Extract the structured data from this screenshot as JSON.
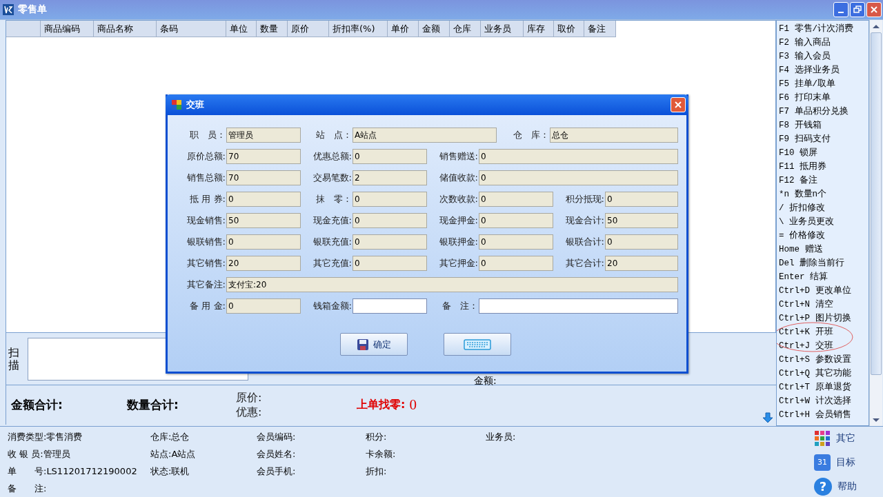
{
  "window": {
    "title": "零售单"
  },
  "table": {
    "columns": [
      "",
      "商品编码",
      "商品名称",
      "条码",
      "单位",
      "数量",
      "原价",
      "折扣率(%)",
      "单价",
      "金额",
      "仓库",
      "业务员",
      "库存",
      "取价",
      "备注"
    ]
  },
  "shortcuts": [
    "F1 零售/计次消费",
    "F2 输入商品",
    "F3 输入会员",
    "F4 选择业务员",
    "F5 挂单/取单",
    "F6 打印末单",
    "F7 单品积分兑换",
    "F8 开钱箱",
    "F9 扫码支付",
    "F10 锁屏",
    "F11 抵用券",
    "F12 备注",
    "*n  数量n个",
    "/ 折扣修改",
    "\\ 业务员更改",
    "= 价格修改",
    "Home 赠送",
    "Del 删除当前行",
    "Enter 结算",
    "Ctrl+D 更改单位",
    "Ctrl+N 清空",
    "Ctrl+P 图片切换",
    "Ctrl+K 开班",
    "Ctrl+J 交班",
    "Ctrl+S 参数设置",
    "Ctrl+Q 其它功能",
    "Ctrl+T 原单退货",
    "Ctrl+W 计次选择",
    "Ctrl+H 会员销售"
  ],
  "scan": {
    "label": "扫描",
    "amount_label": "金额:"
  },
  "totals": {
    "amount_label": "金额合计:",
    "qty_label": "数量合计:",
    "orig_label": "原价:",
    "discount_label": "优惠:",
    "change_label": "上单找零:",
    "change_value": "0"
  },
  "info": [
    [
      {
        "label": "消费类型:",
        "value": "零售消费"
      },
      {
        "label": "仓库:",
        "value": "总仓"
      },
      {
        "label": "会员编码:"
      },
      {
        "label": "积分:"
      },
      {
        "label": "业务员:"
      }
    ],
    [
      {
        "label": "收 银 员:",
        "value": "管理员"
      },
      {
        "label": "站点:",
        "value": "A站点"
      },
      {
        "label": "会员姓名:"
      },
      {
        "label": "卡余额:"
      }
    ],
    [
      {
        "label": "单　　号:",
        "value": "LS11201712190002"
      },
      {
        "label": "状态:",
        "value": "联机"
      },
      {
        "label": "会员手机:"
      },
      {
        "label": "折扣:"
      }
    ],
    [
      {
        "label": "备　　注:"
      }
    ]
  ],
  "side_buttons": [
    {
      "kind": "apps",
      "label": "其它"
    },
    {
      "kind": "calendar",
      "label": "目标",
      "icon_text": "31"
    },
    {
      "kind": "help",
      "label": "帮助",
      "icon_text": "?"
    }
  ],
  "dialog": {
    "title": "交班",
    "rows": [
      [
        {
          "label": "职　员：",
          "value": "管理员",
          "kind": "readonly"
        },
        {
          "label": "站　点：",
          "value": "A站点",
          "kind": "readonly"
        },
        {
          "label": "仓　库：",
          "value": "总仓",
          "kind": "readonly"
        }
      ],
      [
        {
          "label": "原价总额:",
          "value": "70",
          "kind": "readonly"
        },
        {
          "label": "优惠总额:",
          "value": "0",
          "kind": "readonly"
        },
        {
          "label": "销售赠送:",
          "value": "0",
          "kind": "readonly"
        }
      ],
      [
        {
          "label": "销售总额:",
          "value": "70",
          "kind": "readonly"
        },
        {
          "label": "交易笔数:",
          "value": "2",
          "kind": "readonly"
        },
        {
          "label": "储值收款:",
          "value": "0",
          "kind": "readonly"
        }
      ],
      [
        {
          "label": "抵 用 券:",
          "value": "0",
          "kind": "readonly"
        },
        {
          "label": "抹　零：",
          "value": "0",
          "kind": "readonly"
        },
        {
          "label": "次数收款:",
          "value": "0",
          "kind": "readonly"
        },
        {
          "label": "积分抵现:",
          "value": "0",
          "kind": "readonly"
        }
      ],
      [
        {
          "label": "现金销售:",
          "value": "50",
          "kind": "readonly"
        },
        {
          "label": "现金充值:",
          "value": "0",
          "kind": "readonly"
        },
        {
          "label": "现金押金:",
          "value": "0",
          "kind": "readonly"
        },
        {
          "label": "现金合计:",
          "value": "50",
          "kind": "readonly"
        }
      ],
      [
        {
          "label": "银联销售:",
          "value": "0",
          "kind": "readonly"
        },
        {
          "label": "银联充值:",
          "value": "0",
          "kind": "readonly"
        },
        {
          "label": "银联押金:",
          "value": "0",
          "kind": "readonly"
        },
        {
          "label": "银联合计:",
          "value": "0",
          "kind": "readonly"
        }
      ],
      [
        {
          "label": "其它销售:",
          "value": "20",
          "kind": "readonly"
        },
        {
          "label": "其它充值:",
          "value": "0",
          "kind": "readonly"
        },
        {
          "label": "其它押金:",
          "value": "0",
          "kind": "readonly"
        },
        {
          "label": "其它合计:",
          "value": "20",
          "kind": "readonly"
        }
      ],
      [
        {
          "label": "其它备注:",
          "value": "支付宝:20",
          "kind": "readonly"
        }
      ],
      [
        {
          "label": "备 用 金:",
          "value": "0",
          "kind": "readonly"
        },
        {
          "label": "钱箱金额:",
          "kind": "input"
        },
        {
          "label": "备　注：",
          "kind": "input"
        }
      ]
    ],
    "buttons": [
      {
        "kind": "save",
        "label": "确定"
      },
      {
        "kind": "keyboard"
      }
    ]
  }
}
